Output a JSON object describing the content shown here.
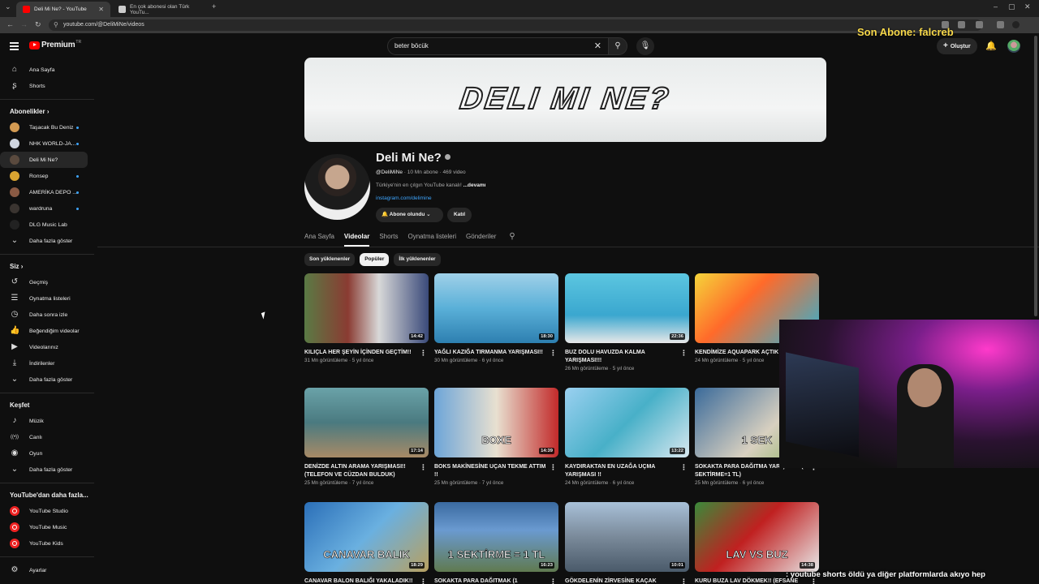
{
  "browser": {
    "tabs": [
      {
        "title": "Deli Mi Ne? - YouTube",
        "active": true,
        "favicon_color": "#ff0000"
      },
      {
        "title": "En çok abonesi olan Türk YouTu...",
        "active": false,
        "favicon_color": "#cccccc"
      }
    ],
    "url": "youtube.com/@DeliMiNe/videos",
    "new_tab_label": "+"
  },
  "stream_overlay": {
    "last_sub": "Son Abone: falcreb",
    "ticker": ": youtube shorts öldü ya diğer platformlarda akıyo hep"
  },
  "masthead": {
    "logo_text": "Premium",
    "logo_mark": "TR",
    "search_value": "beter böcük",
    "create_label": "Oluştur"
  },
  "sidebar": {
    "main": [
      {
        "label": "Ana Sayfa",
        "icon": "home-icon",
        "glyph": "⌂"
      },
      {
        "label": "Shorts",
        "icon": "shorts-icon",
        "glyph": "ʂ"
      }
    ],
    "subs_header": "Abonelikler",
    "subs": [
      {
        "label": "Taşacak Bu Deniz",
        "color": "#d39a52",
        "live": true
      },
      {
        "label": "NHK WORLD-JA...",
        "color": "#cfd5df",
        "live": true
      },
      {
        "label": "Deli Mi Ne?",
        "color": "#5a4a3e",
        "live": false,
        "active": true
      },
      {
        "label": "Ronsep",
        "color": "#d9a431",
        "live": true
      },
      {
        "label": "AMERİKA DEPO ...",
        "color": "#8a5a44",
        "live": true
      },
      {
        "label": "wardruna",
        "color": "#3a3430",
        "live": true
      },
      {
        "label": "DLG Music Lab",
        "color": "#222222",
        "live": false
      }
    ],
    "subs_more": "Daha fazla göster",
    "you_header": "Siz",
    "you": [
      {
        "label": "Geçmiş",
        "icon": "history-icon",
        "glyph": "↺"
      },
      {
        "label": "Oynatma listeleri",
        "icon": "playlists-icon",
        "glyph": "☰"
      },
      {
        "label": "Daha sonra izle",
        "icon": "watch-later-icon",
        "glyph": "◷"
      },
      {
        "label": "Beğendiğim videolar",
        "icon": "like-icon",
        "glyph": "👍"
      },
      {
        "label": "Videolarınız",
        "icon": "your-videos-icon",
        "glyph": "▶"
      },
      {
        "label": "İndirilenler",
        "icon": "download-icon",
        "glyph": "⤓"
      }
    ],
    "you_more": "Daha fazla göster",
    "explore_header": "Keşfet",
    "explore": [
      {
        "label": "Müzik",
        "icon": "music-icon",
        "glyph": "♪"
      },
      {
        "label": "Canlı",
        "icon": "live-icon",
        "glyph": "((•))"
      },
      {
        "label": "Oyun",
        "icon": "gaming-icon",
        "glyph": "◉"
      }
    ],
    "explore_more": "Daha fazla göster",
    "more_header": "YouTube'dan daha fazla...",
    "more": [
      {
        "label": "YouTube Studio"
      },
      {
        "label": "YouTube Music"
      },
      {
        "label": "YouTube Kids"
      }
    ],
    "settings": "Ayarlar"
  },
  "channel": {
    "banner_text": "DELI MI NE?",
    "name": "Deli Mi Ne?",
    "handle": "@DeliMiNe",
    "meta": "· 10 Mn abone · 469 video",
    "desc": "Türkiye'nin en çılgın YouTube kanalı!",
    "desc_more": "...devamı",
    "link": "instagram.com/delimine",
    "subscribed_label": "Abone olundu",
    "join_label": "Katıl",
    "tabs": [
      "Ana Sayfa",
      "Videolar",
      "Shorts",
      "Oynatma listeleri",
      "Gönderiler"
    ],
    "active_tab": 1,
    "chips": [
      "Son yüklenenler",
      "Popüler",
      "İlk yüklenenler"
    ],
    "active_chip": 1
  },
  "videos": [
    {
      "title": "KILIÇLA HER ŞEYİN İÇİNDEN GEÇTİM!!",
      "meta": "31 Mn görüntüleme · 5 yıl önce",
      "duration": "14:42",
      "bg": "linear-gradient(90deg,#5a7a44 0%,#8a3b32 35%,#d8d8d8 60%,#3a4a7a 100%)"
    },
    {
      "title": "YAĞLI KAZIĞA TIRMANMA YARIŞMASI!!",
      "meta": "30 Mn görüntüleme · 6 yıl önce",
      "duration": "18:30",
      "bg": "linear-gradient(180deg,#9fd0e8 0%,#5ab0d8 50%,#2d7fb0 100%)"
    },
    {
      "title": "BUZ DOLU HAVUZDA KALMA YARIŞMASI!!!",
      "meta": "26 Mn görüntüleme · 5 yıl önce",
      "duration": "22:36",
      "bg": "linear-gradient(180deg,#5cc6e0 0%,#3aa7cf 60%,#e8e8e8 100%)"
    },
    {
      "title": "KENDİMİZE AQUAPARK AÇTIK MI NE",
      "meta": "24 Mn görüntüleme · 5 yıl önce",
      "duration": "",
      "bg": "linear-gradient(135deg,#f5d43a 0%,#ff6a2a 40%,#2bb3d6 100%)"
    },
    {
      "title": "DENİZDE ALTIN ARAMA YARIŞMASI!! (TELEFON ve CÜZDAN BULDUK)",
      "meta": "25 Mn görüntüleme · 7 yıl önce",
      "duration": "17:14",
      "bg": "linear-gradient(180deg,#6aa2a8 0%,#4a7a80 50%,#a88a66 100%)"
    },
    {
      "title": "BOKS MAKİNESİNE UÇAN TEKME ATTIM !!",
      "meta": "25 Mn görüntüleme · 7 yıl önce",
      "duration": "14:39",
      "bg": "linear-gradient(90deg,#6da5d8 0%,#e8e0d0 50%,#c22a2a 100%)"
    },
    {
      "title": "KAYDIRAKTAN EN UZAĞA UÇMA YARIŞMASI !!",
      "meta": "24 Mn görüntüleme · 6 yıl önce",
      "duration": "13:22",
      "bg": "linear-gradient(135deg,#9ad0f0 0%,#48b0c8 50%,#d8e8f0 100%)"
    },
    {
      "title": "SOKAKTA PARA DAĞITMA YARIŞMASI (1 SEKTİRME=1 TL)",
      "meta": "25 Mn görüntüleme · 6 yıl önce",
      "duration": "",
      "bg": "linear-gradient(135deg,#3a6a9a 0%,#d8d0c0 60%,#8ab060 100%)"
    },
    {
      "title": "CANAVAR BALON BALIĞI YAKALADIK!!",
      "meta": "",
      "duration": "18:29",
      "bg": "linear-gradient(135deg,#2b6fb8 0%,#6ab0e0 50%,#b8a060 100%)"
    },
    {
      "title": "SOKAKTA PARA DAĞITMAK (1",
      "meta": "",
      "duration": "16:23",
      "bg": "linear-gradient(180deg,#3a6aa0 0%,#6a9ad0 40%,#607a50 100%)"
    },
    {
      "title": "GÖKDELENİN ZİRVESİNE KAÇAK",
      "meta": "",
      "duration": "10:01",
      "bg": "linear-gradient(180deg,#a8c0d8 0%,#7a8a9a 50%,#4a5a6a 100%)"
    },
    {
      "title": "KURU BUZA LAV DÖKMEK!! (EFSANE",
      "meta": "",
      "duration": "14:38",
      "bg": "linear-gradient(135deg,#3a8a3a 0%,#c02020 45%,#e8e8e8 100%)"
    }
  ],
  "thumb_overlays": [
    "",
    "",
    "",
    "",
    "",
    "BOXE",
    "",
    "1 SEK",
    "CANAVAR BALIK",
    "1 SEKTİRME = 1 TL",
    "",
    "LAV VS BUZ"
  ]
}
